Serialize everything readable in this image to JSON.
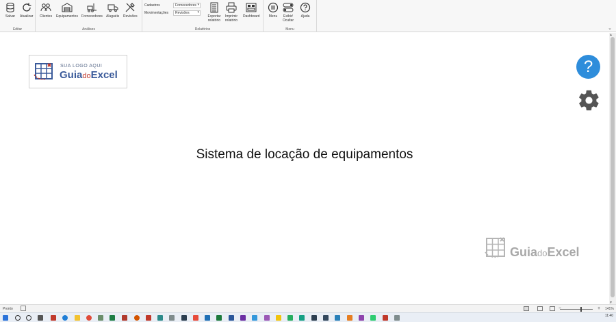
{
  "ribbon": {
    "groups": {
      "editar": "Editar",
      "analises": "Análises",
      "relatorios": "Relatórios",
      "menu": "Menu"
    },
    "buttons": {
      "salvar": "Salvar",
      "atualizar": "Atualizar",
      "clientes": "Clientes",
      "equipamentos": "Equipamentos",
      "fornecedores": "Fornecedores",
      "alugueis": "Aluguéis",
      "revisoes": "Revisões",
      "exportar": "Exportar relatório",
      "imprimir": "Imprimir relatório",
      "dashboard": "Dashboard",
      "menu": "Menu",
      "exibir_ocultar": "Exibir/ Ocultar",
      "ajuda": "Ajuda"
    },
    "combos": {
      "cadastros_label": "Cadastros",
      "cadastros_value": "Fornecedores",
      "movimentacoes_label": "Movimentações",
      "movimentacoes_value": "Revisões"
    }
  },
  "sheet": {
    "logo_small": "SUA LOGO AQUI",
    "logo_brand_a": "Guia",
    "logo_brand_b": "do",
    "logo_brand_c": "Excel",
    "title": "Sistema de locação de equipamentos",
    "help_glyph": "?",
    "watermark_a": "Guia",
    "watermark_b": "do",
    "watermark_c": "Excel"
  },
  "statusbar": {
    "ready": "Pronto",
    "zoom": "141%"
  },
  "taskbar": {
    "time": "11:40"
  },
  "colors": {
    "help_blue": "#2e8ddb",
    "gear_gray": "#555555",
    "brand_blue": "#3a5a9a",
    "brand_red": "#c0392b"
  }
}
